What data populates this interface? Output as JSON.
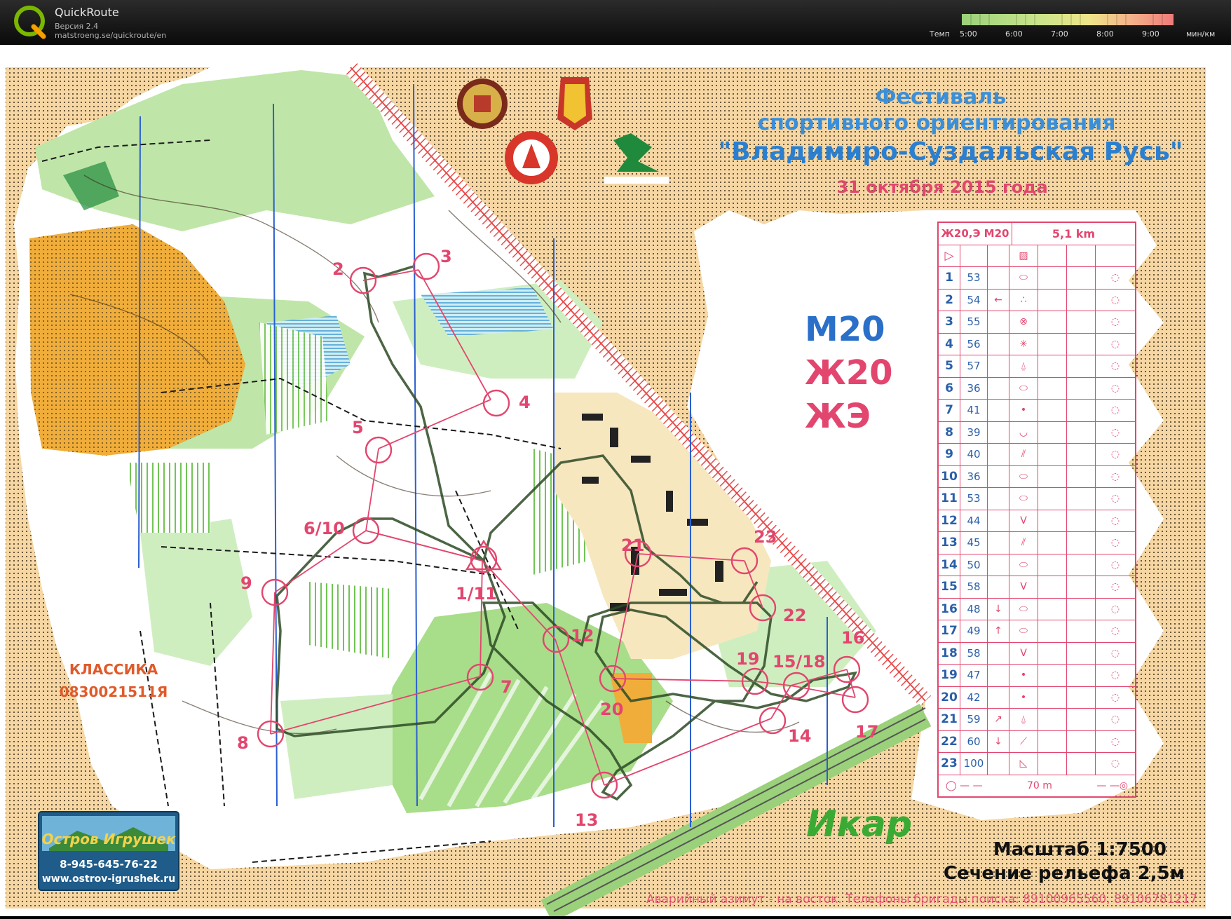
{
  "app": {
    "title": "QuickRoute",
    "version": "Версия 2.4",
    "url": "matstroeng.se/quickroute/en"
  },
  "pace_scale": {
    "label": "Темп",
    "ticks": [
      "5:00",
      "6:00",
      "7:00",
      "8:00",
      "9:00"
    ],
    "unit": "мин/км"
  },
  "event": {
    "title_line1": "Фестиваль",
    "title_line2": "спортивного ориентирования",
    "title_line3": "\"Владимиро-Суздальская Русь\"",
    "date": "31 октября 2015 года"
  },
  "classes": [
    "М20",
    "Ж20",
    "ЖЭ"
  ],
  "map_name": "Икар",
  "stamp": {
    "line1": "КЛАССИКА",
    "line2": "0830021511Я"
  },
  "sponsor": {
    "name": "Остров Игрушек",
    "phone": "8-945-645-76-22",
    "site": "www.ostrov-igrushek.ru"
  },
  "scale_text": "Масштаб 1:7500",
  "contour_text": "Сечение рельефа 2,5м",
  "emergency_text": "Аварийный азимут - на восток. Телефоны бригады поиска: 89100965560, 89106781217",
  "description_sheet": {
    "header_class": "Ж20,Э М20",
    "header_length": "5,1 km",
    "controls": [
      {
        "n": "1",
        "code": "53",
        "dir": "",
        "sym": "⬭"
      },
      {
        "n": "2",
        "code": "54",
        "dir": "←",
        "sym": "∴"
      },
      {
        "n": "3",
        "code": "55",
        "dir": "",
        "sym": "⊗"
      },
      {
        "n": "4",
        "code": "56",
        "dir": "",
        "sym": "✳"
      },
      {
        "n": "5",
        "code": "57",
        "dir": "",
        "sym": "⍙"
      },
      {
        "n": "6",
        "code": "36",
        "dir": "",
        "sym": "⬭"
      },
      {
        "n": "7",
        "code": "41",
        "dir": "",
        "sym": "•"
      },
      {
        "n": "8",
        "code": "39",
        "dir": "",
        "sym": "◡"
      },
      {
        "n": "9",
        "code": "40",
        "dir": "",
        "sym": "⫽"
      },
      {
        "n": "10",
        "code": "36",
        "dir": "",
        "sym": "⬭"
      },
      {
        "n": "11",
        "code": "53",
        "dir": "",
        "sym": "⬭"
      },
      {
        "n": "12",
        "code": "44",
        "dir": "",
        "sym": "V"
      },
      {
        "n": "13",
        "code": "45",
        "dir": "",
        "sym": "⫽"
      },
      {
        "n": "14",
        "code": "50",
        "dir": "",
        "sym": "⬭"
      },
      {
        "n": "15",
        "code": "58",
        "dir": "",
        "sym": "V"
      },
      {
        "n": "16",
        "code": "48",
        "dir": "↓",
        "sym": "⬭"
      },
      {
        "n": "17",
        "code": "49",
        "dir": "↑",
        "sym": "⬭"
      },
      {
        "n": "18",
        "code": "58",
        "dir": "",
        "sym": "V"
      },
      {
        "n": "19",
        "code": "47",
        "dir": "",
        "sym": "•"
      },
      {
        "n": "20",
        "code": "42",
        "dir": "",
        "sym": "•"
      },
      {
        "n": "21",
        "code": "59",
        "dir": "↗",
        "sym": "⍙"
      },
      {
        "n": "22",
        "code": "60",
        "dir": "↓",
        "sym": "⟋"
      },
      {
        "n": "23",
        "code": "100",
        "dir": "",
        "sym": "◺"
      }
    ],
    "finish_distance": "70 m"
  },
  "control_labels": [
    "2",
    "3",
    "4",
    "5",
    "6/10",
    "9",
    "1/11",
    "12",
    "7",
    "8",
    "13",
    "20",
    "21",
    "23",
    "22",
    "19",
    "15/18",
    "16",
    "14",
    "17"
  ]
}
